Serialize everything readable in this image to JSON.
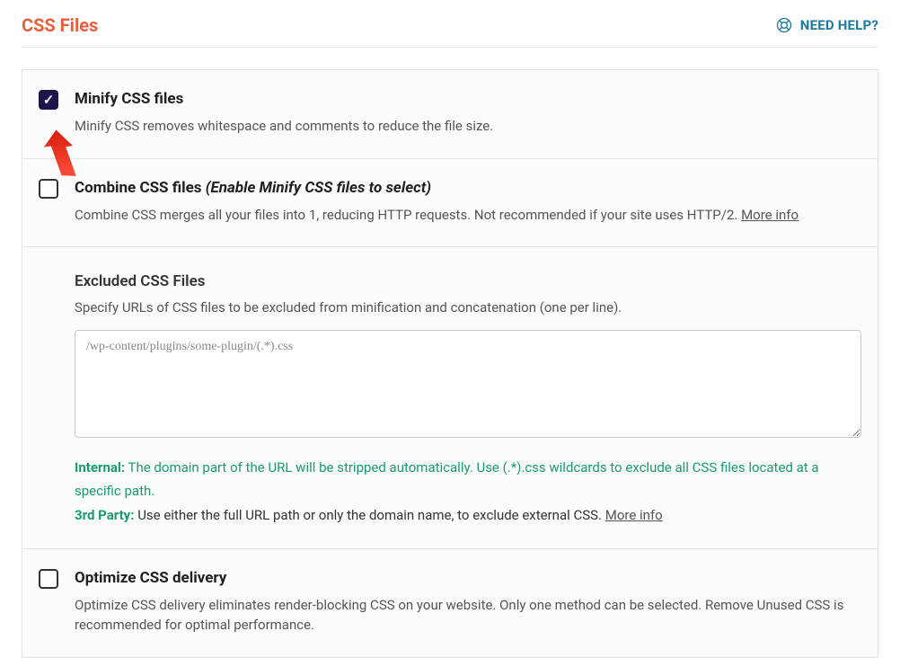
{
  "header": {
    "title": "CSS Files",
    "help": "NEED HELP?"
  },
  "sections": {
    "minify": {
      "title": "Minify CSS files",
      "desc": "Minify CSS removes whitespace and comments to reduce the file size."
    },
    "combine": {
      "title": "Combine CSS files ",
      "subnote": "(Enable Minify CSS files to select)",
      "desc": "Combine CSS merges all your files into 1, reducing HTTP requests. Not recommended if your site uses HTTP/2. ",
      "more": "More info"
    },
    "excluded": {
      "title": "Excluded CSS Files",
      "desc": "Specify URLs of CSS files to be excluded from minification and concatenation (one per line).",
      "placeholder": "/wp-content/plugins/some-plugin/(.*).css",
      "hint_internal_label": "Internal:",
      "hint_internal": " The domain part of the URL will be stripped automatically. Use (.*).css wildcards to exclude all CSS files located at a specific path.",
      "hint_3rd_label": "3rd Party:",
      "hint_3rd": " Use either the full URL path or only the domain name, to exclude external CSS. ",
      "more": "More info"
    },
    "optimize": {
      "title": "Optimize CSS delivery",
      "desc": "Optimize CSS delivery eliminates render-blocking CSS on your website. Only one method can be selected. Remove Unused CSS is recommended for optimal performance."
    }
  }
}
